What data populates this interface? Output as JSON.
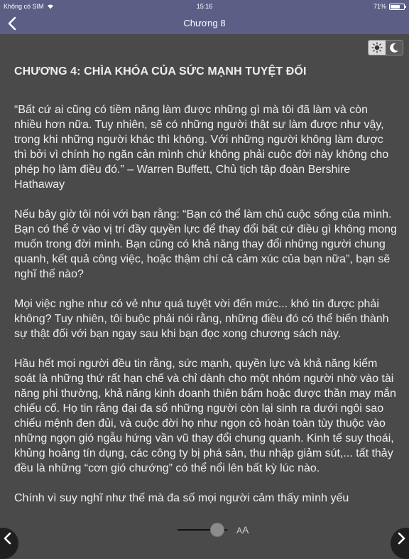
{
  "status_bar": {
    "carrier": "Không có SIM",
    "time": "15:16",
    "battery_percent_text": "71%",
    "battery_level": 0.71
  },
  "nav": {
    "title": "Chương 8"
  },
  "reader": {
    "heading": "CHƯƠNG 4: CHÌA KHÓA CỦA SỨC MẠNH TUYỆT ĐỐI",
    "paragraphs": [
      "“Bất cứ ai cũng có tiềm năng làm được những gì mà tôi đã làm và còn nhiều hơn nữa. Tuy nhiên, sẽ có những người thật sự làm được như vậy, trong khi những người khác thì không. Với những người không làm được thì bởi vì chính họ ngăn cản mình chứ không phải cuộc đời này không cho phép họ làm điều đó.” – Warren Buffett, Chủ tịch tập đoàn Bershire Hathaway",
      "Nếu bây giờ tôi nói với bạn rằng: “Bạn có thể làm chủ cuộc sống của mình. Bạn có thể ở vào vị trí đầy quyền lực để thay đổi bất cứ điều gì không mong muốn trong đời mình. Bạn cũng có khả năng thay đổi những người chung quanh, kết quả công việc, hoặc thậm chí cả cảm xúc của bạn nữa”, bạn sẽ nghĩ thế nào?",
      "Mọi việc nghe như có vẻ như quá tuyệt vời đến mức... khó tin được phải không? Tuy nhiên, tôi buộc phải nói rằng, những điều đó có thể biến thành sự thật đối với bạn ngay sau khi bạn đọc xong chương sách này.",
      "Hầu hết mọi người đều tin rằng, sức mạnh, quyền lực và khả năng kiểm soát là những thứ rất hạn chế và chỉ dành cho một nhóm người nhờ vào tài năng phi thường, khả năng kinh doanh thiên bẩm hoặc được thần may mắn chiếu cố. Họ tin rằng đại đa số những người còn lại sinh ra dưới ngôi sao chiếu mệnh đen đủi, và cuộc đời họ như ngọn cỏ hoàn toàn tùy thuộc vào những ngọn gió ngẫu hứng vần vũ thay đổi chung quanh. Kinh tế suy thoái, khủng hoảng tín dụng, các công ty bị phá sản, thu nhập giảm sút,... tất thảy đều là những “cơn gió chướng” có thể nổi lên bất kỳ lúc nào.",
      "Chính vì suy nghĩ như thế mà đa số mọi người cảm thấy mình yếu"
    ]
  },
  "controls": {
    "font_small": "A",
    "font_large": "A",
    "font_slider_level": 0.8
  },
  "icons": {
    "back": "chevron-left-icon",
    "sun": "sun-icon",
    "moon": "moon-icon",
    "prev": "chevron-left-icon",
    "next": "chevron-right-icon"
  }
}
